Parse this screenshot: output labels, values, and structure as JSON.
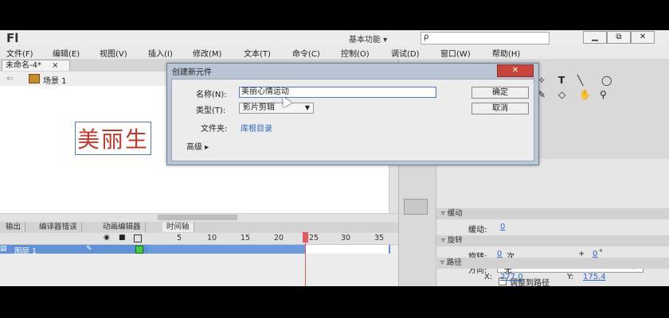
{
  "app": {
    "logo": "Fl",
    "workspace": "基本功能 ▾",
    "search_placeholder": "ρ",
    "window_buttons": [
      "▁",
      "⧉",
      "✕"
    ]
  },
  "menubar": [
    "文件(F)",
    "编辑(E)",
    "视图(V)",
    "插入(I)",
    "修改(M)",
    "文本(T)",
    "命令(C)",
    "控制(O)",
    "调试(D)",
    "窗口(W)",
    "帮助(H)"
  ],
  "document": {
    "tab_label": "未命名-4*",
    "tab_close": "×",
    "scene_label": "场景 1",
    "stage_text": "美丽生"
  },
  "panel_tabs": [
    "输出",
    "编译器错误",
    "动画编辑器",
    "时间轴"
  ],
  "timeline": {
    "ticks": [
      "5",
      "10",
      "15",
      "20",
      "25",
      "30",
      "35"
    ],
    "layer_name": "图层 1"
  },
  "properties": {
    "easing_section": "缓动",
    "easing_label": "缓动:",
    "easing_value": "0",
    "rotation_section": "旋转",
    "rotation_label": "旋转:",
    "rotation_value": "0",
    "rotation_unit": "次",
    "rotation_plus": "+",
    "rotation_deg": "0",
    "rotation_deg_unit": "°",
    "direction_label": "方向:",
    "direction_value": "无",
    "orient_to_path": "调整到路径",
    "path_section": "路径",
    "x_label": "X:",
    "x_value": "277.0",
    "y_label": "Y:",
    "y_value": "175.4"
  },
  "dialog": {
    "title": "创建新元件",
    "close": "✕",
    "name_label": "名称(N):",
    "name_value": "美丽心情运动",
    "type_label": "类型(T):",
    "type_value": "影片剪辑",
    "folder_label": "文件夹:",
    "folder_value": "库根目录",
    "advanced_label": "高级 ▸",
    "ok_button": "确定",
    "cancel_button": "取消"
  }
}
